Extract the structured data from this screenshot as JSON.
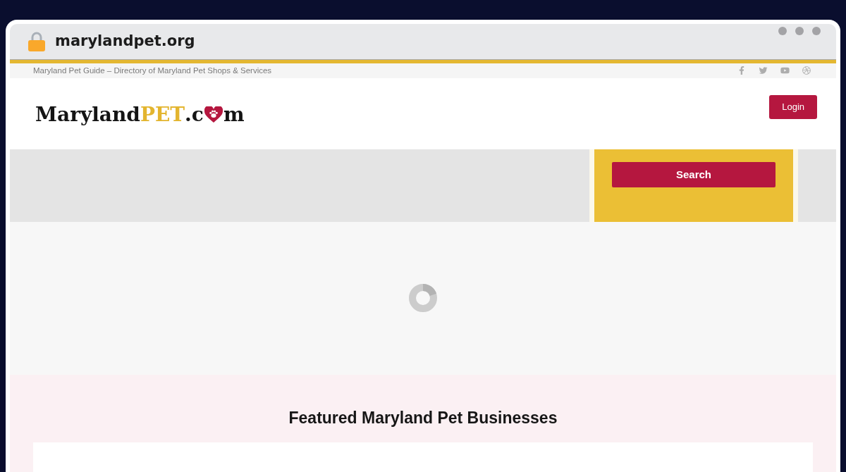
{
  "browser": {
    "url": "marylandpet.org"
  },
  "top_bar": {
    "tagline": "Maryland Pet Guide – Directory of Maryland Pet Shops & Services"
  },
  "header": {
    "logo": {
      "main": "Maryland",
      "highlight": "PET",
      "domain_start": ".c",
      "domain_end": "m"
    },
    "login_button": "Login"
  },
  "search_band": {
    "search_button": "Search"
  },
  "featured_section": {
    "heading": "Featured Maryland Pet Businesses"
  }
}
